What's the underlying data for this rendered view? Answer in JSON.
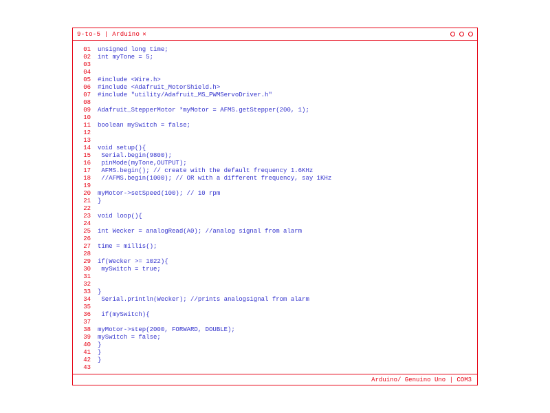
{
  "window": {
    "title": "9-to-5 | Arduino",
    "close_glyph": "✕"
  },
  "status": {
    "board": "Arduino/ Genuino Uno | COM3"
  },
  "colors": {
    "accent": "#e60012",
    "code": "#3232cc"
  },
  "code_lines": [
    "unsigned long time;",
    "int myTone = 5;",
    "",
    "",
    "#include <Wire.h>",
    "#include <Adafruit_MotorShield.h>",
    "#include \"utility/Adafruit_MS_PWMServoDriver.h\"",
    "",
    "Adafruit_StepperMotor *myMotor = AFMS.getStepper(200, 1);",
    "",
    "boolean mySwitch = false;",
    "",
    "",
    "void setup(){",
    " Serial.begin(9800);",
    " pinMode(myTone,OUTPUT);",
    " AFMS.begin(); // create with the default frequency 1.6KHz",
    " //AFMS.begin(1000); // OR with a different frequency, say 1KHz",
    "",
    "myMotor->setSpeed(100); // 10 rpm",
    "}",
    "",
    "void loop(){",
    "",
    "int Wecker = analogRead(A0); //analog signal from alarm",
    "",
    "time = millis();",
    "",
    "if(Wecker >= 1022){",
    " mySwitch = true;",
    "",
    "",
    "}",
    " Serial.println(Wecker); //prints analogsignal from alarm",
    "",
    " if(mySwitch){",
    "",
    "myMotor->step(2000, FORWARD, DOUBLE);",
    "mySwitch = false;",
    "}",
    "}",
    "}",
    ""
  ]
}
